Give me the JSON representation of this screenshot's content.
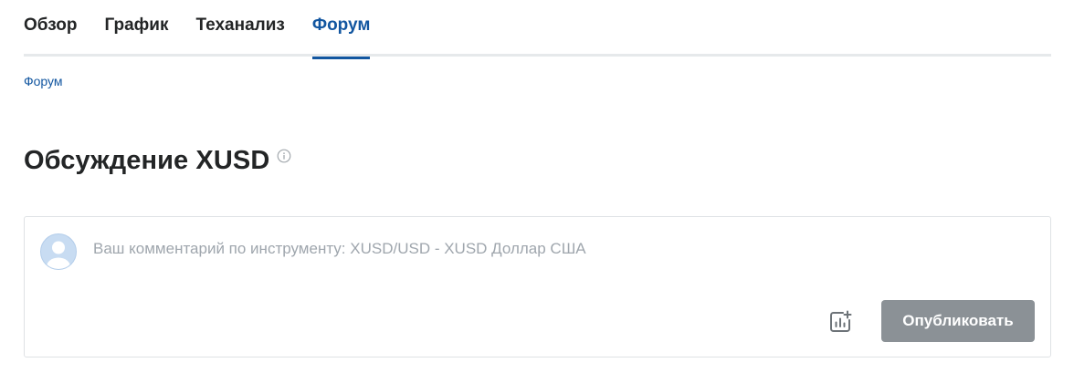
{
  "tabs": [
    {
      "label": "Обзор",
      "active": false
    },
    {
      "label": "График",
      "active": false
    },
    {
      "label": "Теханализ",
      "active": false
    },
    {
      "label": "Форум",
      "active": true
    }
  ],
  "breadcrumb": {
    "label": "Форум"
  },
  "header": {
    "title": "Обсуждение XUSD",
    "info_icon": "info-circle-icon"
  },
  "comment": {
    "placeholder": "Ваш комментарий по инструменту: XUSD/USD - XUSD Доллар США",
    "value": "",
    "avatar_icon": "user-avatar-icon",
    "attach_chart_icon": "chart-add-icon",
    "publish_label": "Опубликовать"
  },
  "colors": {
    "accent": "#1256a0",
    "text": "#232526",
    "publish_button_bg": "#8b9196",
    "tab_border": "#e6e9eb",
    "placeholder": "#9fa6ad"
  }
}
